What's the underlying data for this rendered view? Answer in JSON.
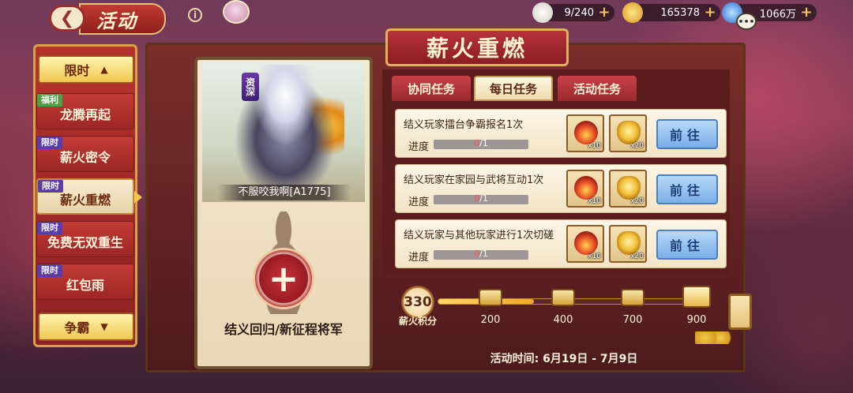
{
  "header": {
    "back_icon": "back-arrow-icon",
    "title": "活动",
    "resources": [
      {
        "icon": "rice-cake-icon",
        "value": "9/240"
      },
      {
        "icon": "gold-ingot-icon",
        "value": "165378"
      },
      {
        "icon": "coin-icon",
        "value": "1066万"
      }
    ],
    "plus_label": "+",
    "chat_label": "•••"
  },
  "sidebar": {
    "top_header": "限时",
    "top_header_icon": "▲",
    "bottom_header": "争霸",
    "bottom_header_icon": "▼",
    "items": [
      {
        "tag": "福利",
        "label": "龙腾再起"
      },
      {
        "tag": "限时",
        "label": "薪火密令"
      },
      {
        "tag": "限时",
        "label": "薪火重燃"
      },
      {
        "tag": "限时",
        "label": "免费无双重生"
      },
      {
        "tag": "限时",
        "label": "红包雨"
      }
    ]
  },
  "banner": {
    "title": "薪火重燃"
  },
  "hero": {
    "rank": "资深",
    "name": "不服咬我啊[A1775]",
    "add_icon": "+",
    "return_label": "结义回归/新征程将军"
  },
  "tabs": [
    {
      "label": "协同任务"
    },
    {
      "label": "每日任务"
    },
    {
      "label": "活动任务"
    }
  ],
  "tasks": [
    {
      "desc": "结义玩家擂台争霸报名1次",
      "progress_label": "进度",
      "current": "0",
      "total": "/1",
      "progress": 0,
      "rewards": [
        {
          "icon": "fire-bowl-icon",
          "count": "x10"
        },
        {
          "icon": "gold-ingot-icon",
          "count": "x20"
        }
      ],
      "button": "前往"
    },
    {
      "desc": "结义玩家在家园与武将互动1次",
      "progress_label": "进度",
      "current": "0",
      "total": "/1",
      "progress": 0,
      "rewards": [
        {
          "icon": "fire-bowl-icon",
          "count": "x10"
        },
        {
          "icon": "gold-ingot-icon",
          "count": "x20"
        }
      ],
      "button": "前往"
    },
    {
      "desc": "结义玩家与其他玩家进行1次切磋",
      "progress_label": "进度",
      "current": "0",
      "total": "/1",
      "progress": 0,
      "rewards": [
        {
          "icon": "fire-bowl-icon",
          "count": "x10"
        },
        {
          "icon": "gold-ingot-icon",
          "count": "x20"
        }
      ],
      "button": "前往"
    }
  ],
  "points": {
    "value": "330",
    "label": "薪火积分",
    "fill_fraction": 0.37,
    "milestones": [
      "200",
      "400",
      "700",
      "900"
    ]
  },
  "event_time": "活动时间:  6月19日 - 7月9日"
}
